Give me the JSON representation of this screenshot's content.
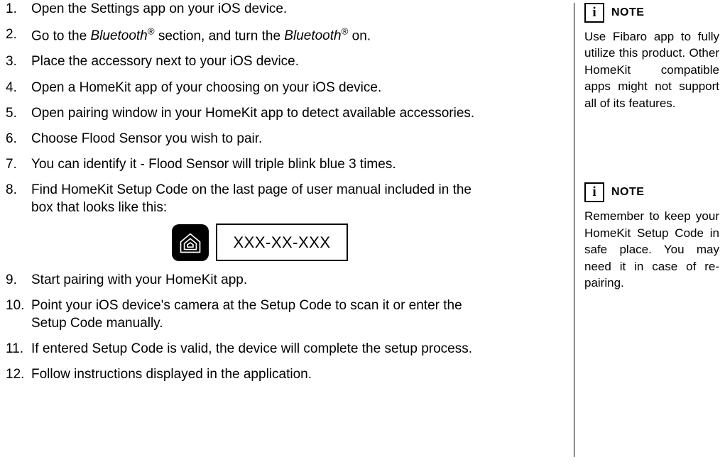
{
  "steps": {
    "1": "Open the Settings app on your iOS device.",
    "2_pre": "Go to the ",
    "2_em1": "Bluetooth",
    "2_mid": " section, and turn the ",
    "2_em2": "Bluetooth",
    "2_post": " on.",
    "reg": "®",
    "3": "Place the accessory next to your iOS device.",
    "4": "Open a HomeKit app of your choosing on your iOS device.",
    "5": "Open pairing window in your HomeKit app to detect available accessories.",
    "6": "Choose Flood Sensor you wish to pair.",
    "7": "You can identify it - Flood Sensor will triple blink blue 3 times.",
    "8": "Find HomeKit Setup Code on the last page of user manual included in the box that looks like this:",
    "code_placeholder": "XXX-XX-XXX",
    "9": "Start pairing with your HomeKit app.",
    "10": "Point your iOS device's camera at the Setup Code to scan it or enter the Setup Code manually.",
    "11": "If entered Setup Code is valid, the device will complete the setup process.",
    "12": "Follow instructions displayed in the application."
  },
  "notes": {
    "label": "NOTE",
    "info_glyph": "i",
    "body1": "Use Fibaro app to fully utilize this product. Other HomeKit compatible apps might not support all of its features.",
    "body2": "Remember to keep your HomeKit Setup Code in safe place. You may need it in case of re-pairing."
  }
}
